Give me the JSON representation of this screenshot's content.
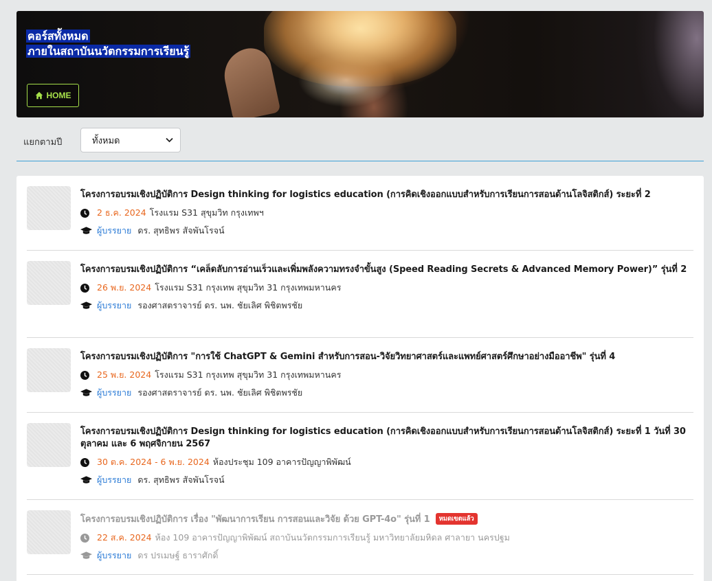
{
  "banner": {
    "title_line1": "คอร์สทั้งหมด",
    "title_line2": "ภายในสถาบันนวัตกรรมการเรียนรู้",
    "home_label": "HOME"
  },
  "filter": {
    "label": "แยกตามปี",
    "selected": "ทั้งหมด"
  },
  "lecturer_label": "ผู้บรรยาย",
  "courses": [
    {
      "title": "โครงการอบรมเชิงปฏิบัติการ Design thinking for logistics education (การคิดเชิงออกแบบสำหรับการเรียนการสอนด้านโลจิสติกส์) ระยะที่ 2",
      "date": "2 ธ.ค. 2024",
      "place": "โรงแรม S31 สุขุมวิท กรุงเทพฯ",
      "lecturer": "ดร. สุทธิพร สัจพันโรจน์"
    },
    {
      "title": "โครงการอบรมเชิงปฏิบัติการ “เคล็ดลับการอ่านเร็วและเพิ่มพลังความทรงจำขั้นสูง (Speed Reading Secrets & Advanced Memory Power)” รุ่นที่ 2",
      "date": "26 พ.ย. 2024",
      "place": "โรงแรม S31 กรุงเทพ สุขุมวิท 31 กรุงเทพมหานคร",
      "lecturer": "รองศาสตราจารย์ ดร. นพ. ชัยเลิศ พิชิตพรชัย"
    },
    {
      "title": "โครงการอบรมเชิงปฏิบัติการ \"การใช้ ChatGPT & Gemini สำหรับการสอน-วิจัยวิทยาศาสตร์และแพทย์ศาสตร์ศึกษาอย่างมืออาชีพ\" รุ่นที่ 4",
      "date": "25 พ.ย. 2024",
      "place": "โรงแรม S31 กรุงเทพ สุขุมวิท 31 กรุงเทพมหานคร",
      "lecturer": "รองศาสตราจารย์ ดร. นพ. ชัยเลิศ พิชิตพรชัย"
    },
    {
      "title": "โครงการอบรมเชิงปฏิบัติการ Design thinking for logistics education (การคิดเชิงออกแบบสำหรับการเรียนการสอนด้านโลจิสติกส์) ระยะที่ 1 วันที่ 30 ตุลาคม และ 6 พฤศจิกายน 2567",
      "date": "30 ต.ค. 2024 - 6 พ.ย. 2024",
      "place": "ห้องประชุม 109 อาคารปัญญาพิพัฒน์",
      "lecturer": "ดร. สุทธิพร สัจพันโรจน์"
    },
    {
      "title": "โครงการอบรมเชิงปฏิบัติการ เรื่อง \"พัฒนาการเรียน การสอนและวิจัย ด้วย GPT-4o\" รุ่นที่ 1",
      "badge": "หมดเขตแล้ว",
      "date": "22 ส.ค. 2024",
      "place": "ห้อง 109 อาคารปัญญาพิพัฒน์ สถาบันนวัตกรรมการเรียนรู้ มหาวิทยาลัยมหิดล ศาลายา นครปฐม",
      "lecturer": "ดร ปรเมษฐ์ ธาราศักดิ์"
    }
  ]
}
